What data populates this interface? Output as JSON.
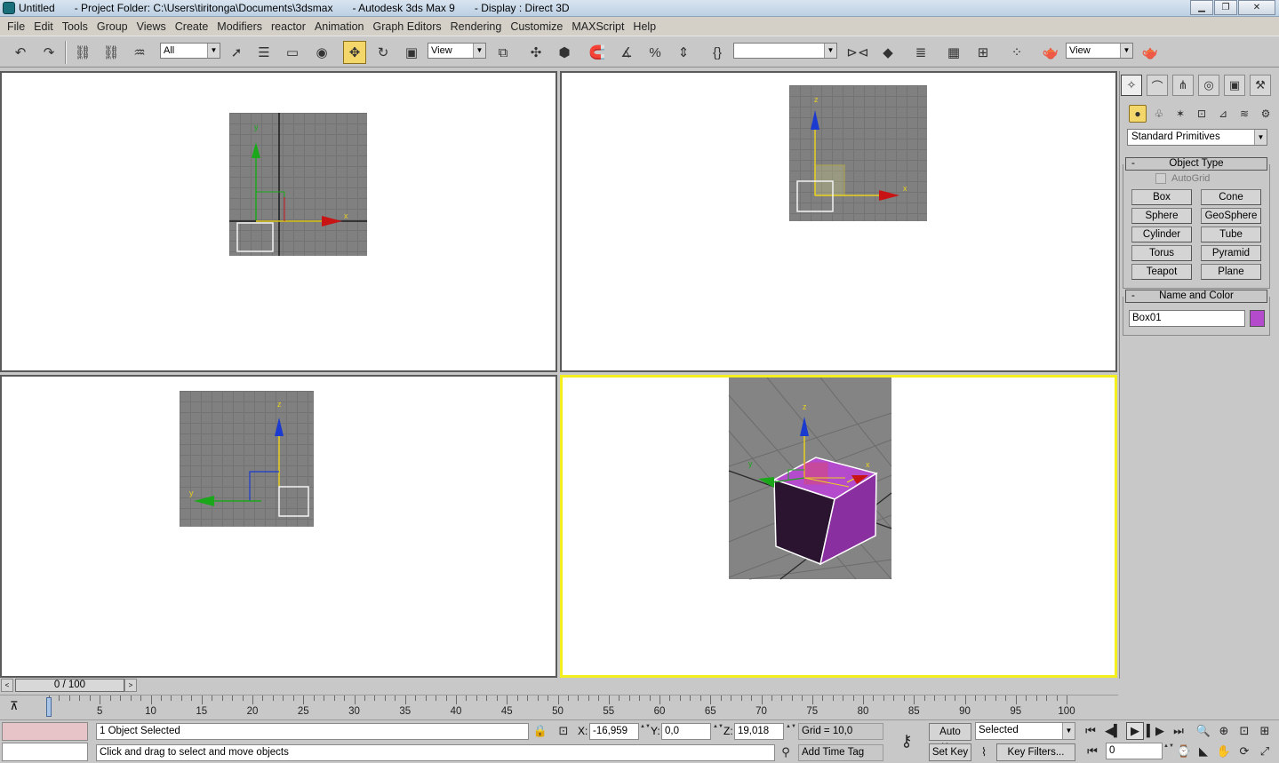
{
  "title_bar": {
    "doc": "Untitled",
    "project": "- Project Folder: C:\\Users\\tiritonga\\Documents\\3dsmax",
    "app": "- Autodesk 3ds Max 9",
    "display": "- Display : Direct 3D",
    "buttons": [
      "minimize",
      "maximize",
      "close"
    ]
  },
  "menu": [
    "File",
    "Edit",
    "Tools",
    "Group",
    "Views",
    "Create",
    "Modifiers",
    "reactor",
    "Animation",
    "Graph Editors",
    "Rendering",
    "Customize",
    "MAXScript",
    "Help"
  ],
  "toolbar": {
    "selection_filter": "All",
    "ref_coord": "View",
    "named_selection": "",
    "render_view": "View",
    "active_tool": "select-and-move"
  },
  "viewports": {
    "top": {
      "axis_labels": [
        "y",
        "x"
      ]
    },
    "front": {
      "axis_labels": [
        "z",
        "x"
      ]
    },
    "left": {
      "axis_labels": [
        "z",
        "y"
      ]
    },
    "perspective": {
      "axis_labels": [
        "z",
        "y",
        "x"
      ],
      "active": true,
      "active_border_color": "#f3ee1e"
    }
  },
  "command_panel": {
    "tabs": [
      "create",
      "modify",
      "hierarchy",
      "motion",
      "display",
      "utilities"
    ],
    "subtabs": [
      "geometry",
      "shapes",
      "lights",
      "cameras",
      "helpers",
      "space-warps",
      "systems"
    ],
    "category": "Standard Primitives",
    "object_type": {
      "title": "Object Type",
      "autogrid": "AutoGrid",
      "buttons": [
        "Box",
        "Cone",
        "Sphere",
        "GeoSphere",
        "Cylinder",
        "Tube",
        "Torus",
        "Pyramid",
        "Teapot",
        "Plane"
      ]
    },
    "name_and_color": {
      "title": "Name and Color",
      "name": "Box01",
      "color": "#b44bcc"
    },
    "minus": "-"
  },
  "time_slider": {
    "label": "0 / 100"
  },
  "track_bar": {
    "ticks": [
      "0",
      "5",
      "10",
      "15",
      "20",
      "25",
      "30",
      "35",
      "40",
      "45",
      "50",
      "55",
      "60",
      "65",
      "70",
      "75",
      "80",
      "85",
      "90",
      "95",
      "100"
    ]
  },
  "status": {
    "selection": "1 Object Selected",
    "prompt": "Click and drag to select and move objects",
    "x_label": "X:",
    "x": "-16,959",
    "y_label": "Y:",
    "y": "0,0",
    "z_label": "Z:",
    "z": "19,018",
    "grid": "Grid = 10,0",
    "add_time_tag": "Add Time Tag",
    "auto_key": "Auto Key",
    "set_key": "Set Key",
    "key_mode": "Selected",
    "key_filters": "Key Filters...",
    "frame": "0"
  }
}
